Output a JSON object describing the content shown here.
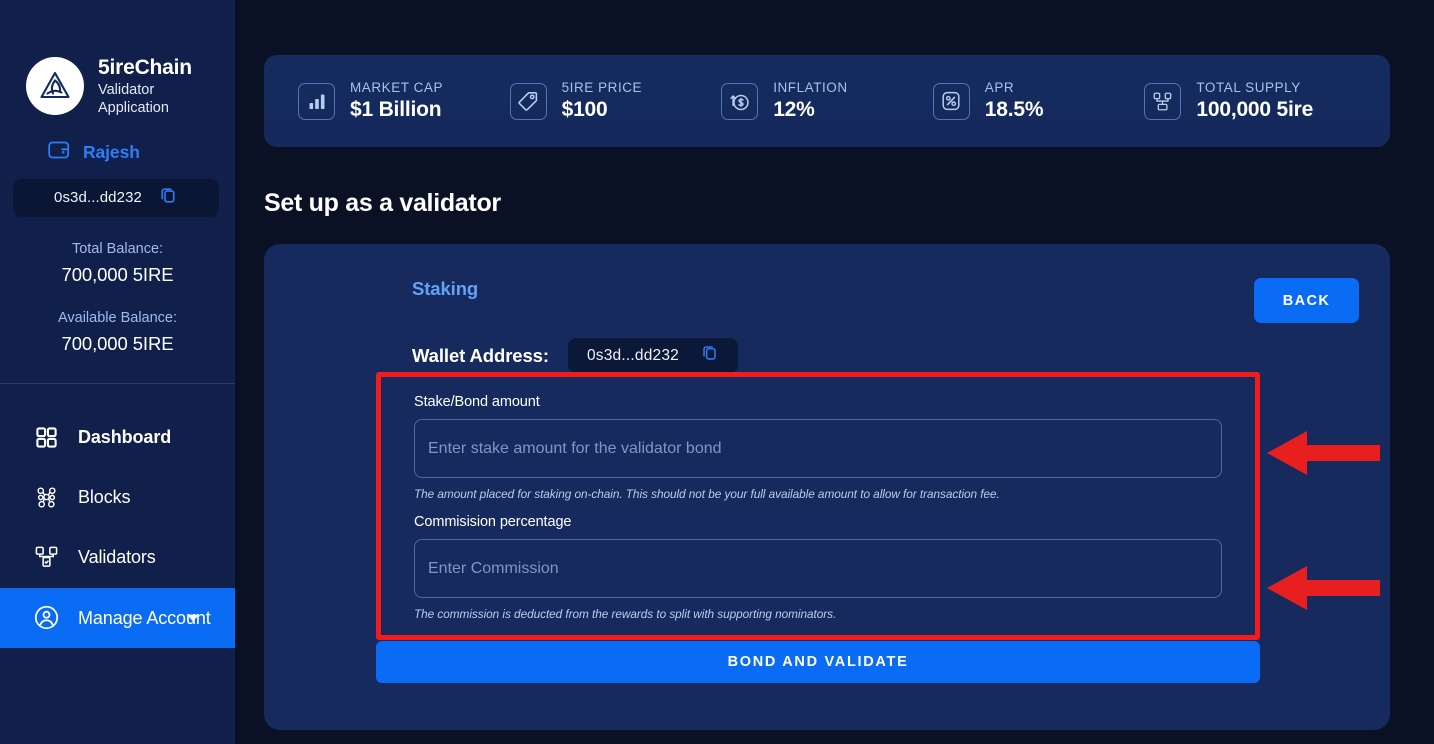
{
  "brand": {
    "name": "5ireChain",
    "subtitle_line1": "Validator",
    "subtitle_line2": "Application",
    "logo_icon": "5ire-triangle-logo"
  },
  "sidebar": {
    "wallet_icon": "wallet-icon",
    "user_name": "Rajesh",
    "address": "0s3d...dd232",
    "copy_icon": "copy-icon",
    "total_balance_label": "Total Balance:",
    "total_balance_value": "700,000 5IRE",
    "available_balance_label": "Available Balance:",
    "available_balance_value": "700,000 5IRE",
    "nav": [
      {
        "label": "Dashboard",
        "icon": "grid-dashboard-icon",
        "active": true
      },
      {
        "label": "Blocks",
        "icon": "blocks-network-icon",
        "active": false
      },
      {
        "label": "Validators",
        "icon": "validators-node-icon",
        "active": false
      },
      {
        "label": "Manage Account",
        "icon": "user-circle-icon",
        "active": false,
        "highlighted": true,
        "caret": "chevron-down-icon"
      }
    ]
  },
  "stats": [
    {
      "label": "MARKET CAP",
      "value": "$1 Billion",
      "icon": "bar-chart-icon"
    },
    {
      "label": "5IRE PRICE",
      "value": "$100",
      "icon": "price-tag-icon"
    },
    {
      "label": "INFLATION",
      "value": "12%",
      "icon": "inflation-dollar-icon"
    },
    {
      "label": "APR",
      "value": "18.5%",
      "icon": "percent-icon"
    },
    {
      "label": "TOTAL SUPPLY",
      "value": "100,000 5ire",
      "icon": "supply-network-icon"
    }
  ],
  "main": {
    "page_title": "Set up as a validator",
    "staking_title": "Staking",
    "back_label": "BACK",
    "wallet_address_label": "Wallet Address:",
    "wallet_address_value": "0s3d...dd232",
    "copy_icon": "copy-icon",
    "stake_field": {
      "label": "Stake/Bond amount",
      "value": "",
      "placeholder": "Enter stake amount for the validator bond",
      "hint": "The amount placed for staking on-chain. This should not be your full available amount to allow for transaction fee."
    },
    "commission_field": {
      "label": "Commisision percentage",
      "value": "",
      "placeholder": "Enter Commission",
      "hint": "The commission is deducted from the rewards to split with supporting nominators."
    },
    "submit_label": "BOND AND VALIDATE"
  },
  "annotations": {
    "highlight_color": "#f41b1b",
    "arrows": [
      {
        "name": "arrow-to-stake-field",
        "direction": "left"
      },
      {
        "name": "arrow-to-commission-field",
        "direction": "left"
      }
    ]
  },
  "colors": {
    "page_bg": "#0a1124",
    "sidebar_bg": "#11204a",
    "panel_bg": "#162a5e",
    "accent_blue": "#0a6cf5",
    "link_blue": "#63a2f7",
    "highlight_red": "#f41b1b"
  }
}
